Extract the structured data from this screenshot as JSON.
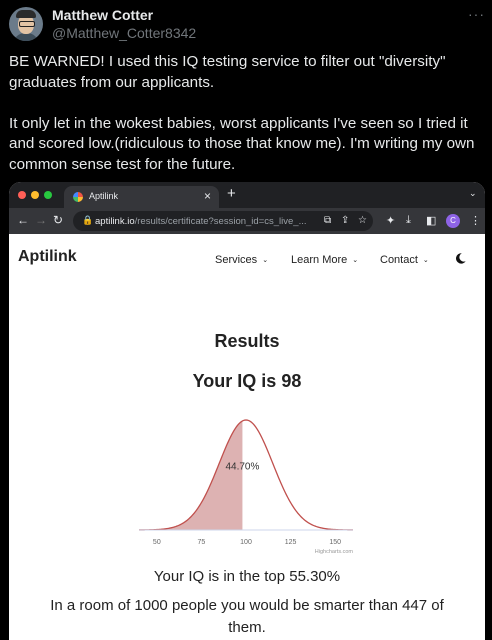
{
  "tweet": {
    "author_name": "Matthew Cotter",
    "handle": "@Matthew_Cotter8342",
    "text": "BE WARNED! I used this IQ testing service to filter out \"diversity\" graduates from our applicants.\n\nIt only let in the wokest babies, worst applicants I've seen so I tried it and scored low.(ridiculous to those that know me). I'm writing my own common sense test for the future."
  },
  "browser": {
    "tab_title": "Aptilink",
    "url_domain": "aptilink.io",
    "url_path": "/results/certificate?session_id=cs_live_...",
    "profile_initial": "C",
    "traffic_light_colors": [
      "#ff5f57",
      "#febc2e",
      "#28c840"
    ]
  },
  "site": {
    "logo": "Aptilink",
    "nav": [
      {
        "label": "Services"
      },
      {
        "label": "Learn More"
      },
      {
        "label": "Contact"
      }
    ],
    "heading": "Results",
    "score_text": "Your IQ is 98",
    "top_percent_text": "Your IQ is in the top 55.30%",
    "room_text": "In a room of 1000 people you would be smarter than 447 of them."
  },
  "chart_data": {
    "type": "area",
    "distribution": "normal",
    "mean": 100,
    "sd": 15,
    "x_ticks": [
      50,
      75,
      100,
      125,
      150
    ],
    "xlim": [
      40,
      160
    ],
    "shaded_upto": 98,
    "shaded_label": "44.70%",
    "credit": "Highcharts.com",
    "line_color": "#c0504d",
    "fill_color": "#ddb2b2"
  }
}
